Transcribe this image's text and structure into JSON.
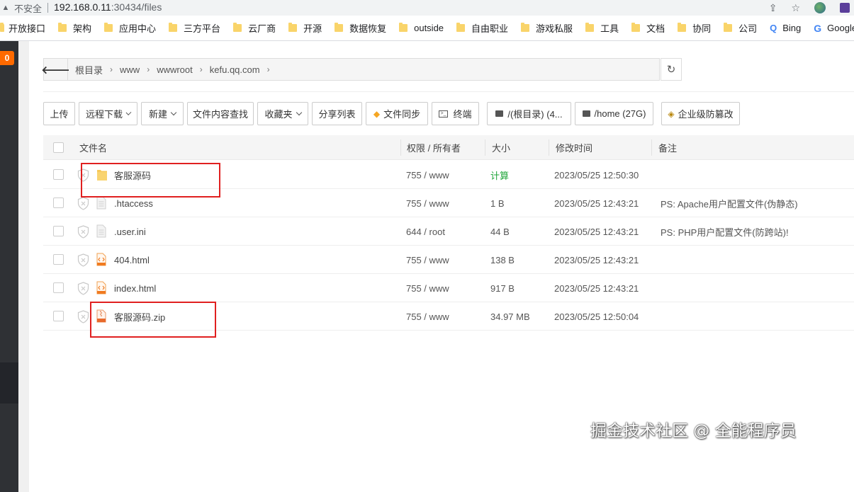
{
  "browser": {
    "security_label": "不安全",
    "url_host": "192.168.0.11",
    "url_path": ":30434/files"
  },
  "bookmarks": [
    {
      "label": "开放接口"
    },
    {
      "label": "架构"
    },
    {
      "label": "应用中心"
    },
    {
      "label": "三方平台"
    },
    {
      "label": "云厂商"
    },
    {
      "label": "开源"
    },
    {
      "label": "数据恢复"
    },
    {
      "label": "outside"
    },
    {
      "label": "自由职业"
    },
    {
      "label": "游戏私服"
    },
    {
      "label": "工具"
    },
    {
      "label": "文档"
    },
    {
      "label": "协同"
    },
    {
      "label": "公司"
    },
    {
      "label": "Bing"
    },
    {
      "label": "Google"
    }
  ],
  "sidebar": {
    "badge": "0"
  },
  "breadcrumb": {
    "items": [
      "根目录",
      "www",
      "wwwroot",
      "kefu.qq.com"
    ]
  },
  "toolbar": {
    "upload": "上传",
    "remote_download": "远程下载",
    "new": "新建",
    "content_search": "文件内容查找",
    "favorites": "收藏夹",
    "share_list": "分享列表",
    "file_sync": "文件同步",
    "terminal": "终端",
    "disk_root": "/(根目录) (4...",
    "disk_home": "/home (27G)",
    "tamper_proof": "企业级防篡改"
  },
  "table": {
    "headers": {
      "name": "文件名",
      "perm": "权限 / 所有者",
      "size": "大小",
      "mtime": "修改时间",
      "note": "备注"
    },
    "rows": [
      {
        "name": "客服源码",
        "perm": "755 / www",
        "size": "计算",
        "mtime": "2023/05/25 12:50:30",
        "note": ""
      },
      {
        "name": ".htaccess",
        "perm": "755 / www",
        "size": "1 B",
        "mtime": "2023/05/25 12:43:21",
        "note": "PS: Apache用户配置文件(伪静态)"
      },
      {
        "name": ".user.ini",
        "perm": "644 / root",
        "size": "44 B",
        "mtime": "2023/05/25 12:43:21",
        "note": "PS: PHP用户配置文件(防跨站)!"
      },
      {
        "name": "404.html",
        "perm": "755 / www",
        "size": "138 B",
        "mtime": "2023/05/25 12:43:21",
        "note": ""
      },
      {
        "name": "index.html",
        "perm": "755 / www",
        "size": "917 B",
        "mtime": "2023/05/25 12:43:21",
        "note": ""
      },
      {
        "name": "客服源码.zip",
        "perm": "755 / www",
        "size": "34.97 MB",
        "mtime": "2023/05/25 12:50:04",
        "note": ""
      }
    ]
  },
  "watermark": "掘金技术社区 @ 全能程序员",
  "colors": {
    "accent_green": "#20a53a",
    "badge_orange": "#ff6a00",
    "highlight_red": "#e02020",
    "sidebar_dark": "#2f3135"
  }
}
